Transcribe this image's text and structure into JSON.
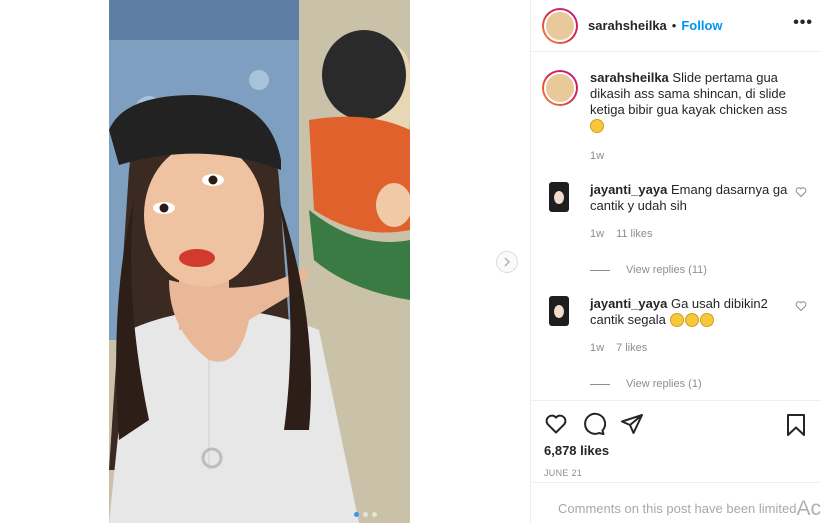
{
  "post": {
    "username": "sarahsheilka",
    "separator": "•",
    "follow_label": "Follow",
    "more_label": "•••",
    "caption": {
      "username": "sarahsheilka",
      "text": "Slide pertama gua dikasih ass sama shincan, di slide ketiga bibir gua kayak chicken ass",
      "emoji": "laughing-face-emoji",
      "time": "1w"
    },
    "comments": [
      {
        "username": "jayanti_yaya",
        "text": "Emang dasarnya ga cantik y udah sih",
        "time": "1w",
        "likes": "11 likes",
        "view_replies": "View replies (11)"
      },
      {
        "username": "jayanti_yaya",
        "text": "Ga usah dibikin2 cantik segala",
        "emojis": [
          "grinning-face-emoji",
          "grinning-face-emoji",
          "grinning-face-emoji"
        ],
        "time": "1w",
        "likes": "7 likes",
        "view_replies": "View replies (1)"
      }
    ],
    "likes_count": "6,878 likes",
    "date": "JUNE 21",
    "comments_limited": "Comments on this post have been limited",
    "carousel": {
      "total": 3,
      "active_index": 0
    }
  },
  "watermark_text": "Ac",
  "colors": {
    "accent": "#0095f6",
    "muted": "#8e8e8e",
    "dot_active": "#3897f0"
  }
}
